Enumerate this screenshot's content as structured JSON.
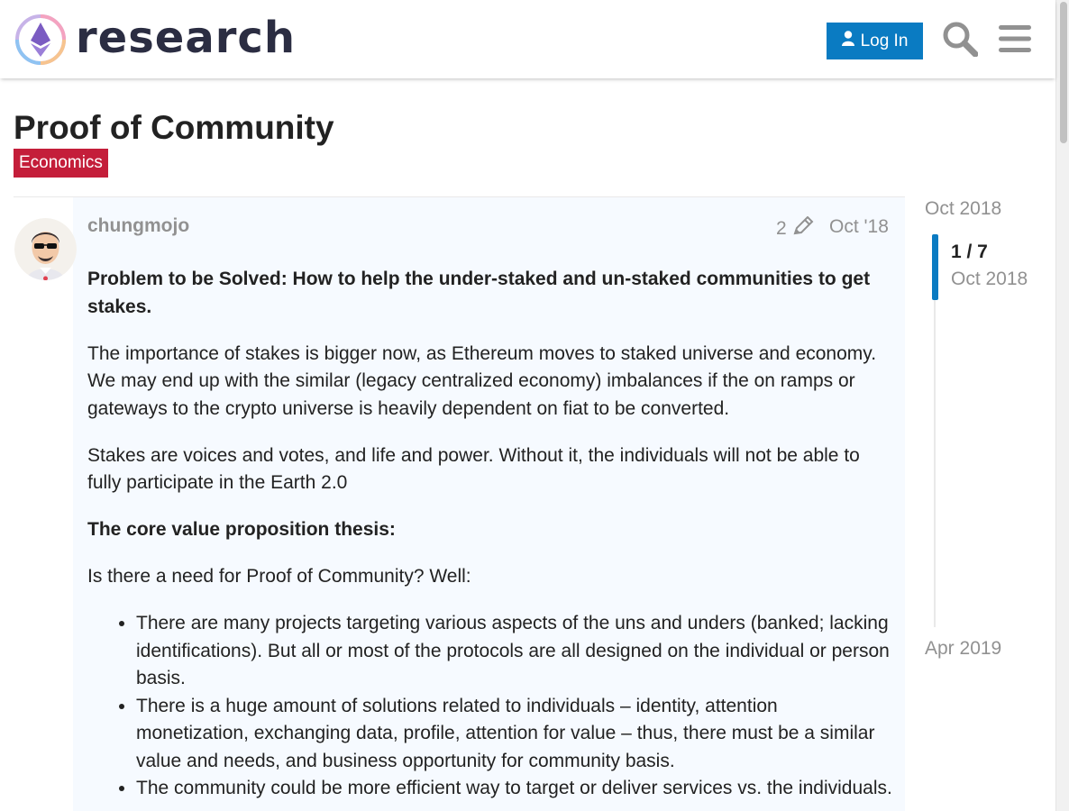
{
  "header": {
    "site_name": "research",
    "login_label": "Log In",
    "search_icon": "search-icon",
    "menu_icon": "hamburger-menu-icon"
  },
  "topic": {
    "title": "Proof of Community",
    "category": "Economics",
    "category_color": "#c41e3a"
  },
  "post": {
    "username": "chungmojo",
    "edit_count": "2",
    "date": "Oct '18",
    "problem_heading": "Problem to be Solved: How to help the under-staked and un-staked communities to get stakes.",
    "para1": "The importance of stakes is bigger now, as Ethereum moves to staked universe and economy. We may end up with the similar (legacy centralized economy) imbalances if the on ramps or gateways to the crypto universe is heavily dependent on fiat to be converted.",
    "para2": "Stakes are voices and votes, and life and power. Without it, the individuals will not be able to fully participate in the Earth 2.0",
    "thesis_heading": "The core value proposition thesis:",
    "para3": "Is there a need for Proof of Community? Well:",
    "bullets": [
      "There are many projects targeting various aspects of the uns and unders (banked; lacking identifications). But all or most of the protocols are all designed on the individual or person basis.",
      "There is a huge amount of solutions related to individuals – identity, attention monetization, exchanging data, profile, attention for value – thus, there must be a similar value and needs, and business opportunity for community basis.",
      "The community could be more efficient way to target or deliver services vs. the individuals."
    ]
  },
  "timeline": {
    "start": "Oct 2018",
    "position": "1 / 7",
    "position_date": "Oct 2018",
    "end": "Apr 2019"
  },
  "colors": {
    "accent": "#0a7bc2",
    "muted_text": "#919191"
  }
}
